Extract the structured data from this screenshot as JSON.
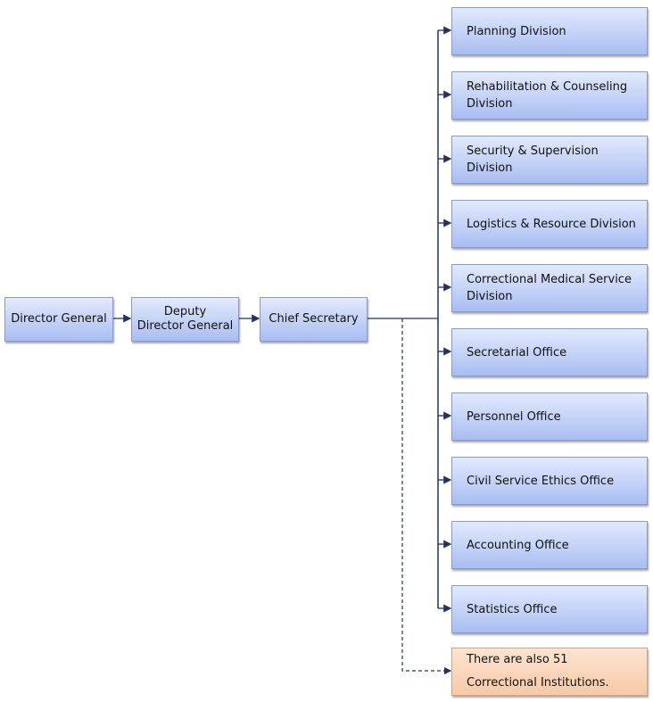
{
  "chain": [
    {
      "label": "Director General"
    },
    {
      "label": "Deputy\nDirector General",
      "line1": "Deputy",
      "line2": "Director General"
    },
    {
      "label": "Chief Secretary"
    }
  ],
  "units": [
    {
      "line1": "Planning Division",
      "line2": ""
    },
    {
      "line1": "Rehabilitation & Counseling",
      "line2": "Division"
    },
    {
      "line1": "Security & Supervision",
      "line2": "Division"
    },
    {
      "line1": "Logistics & Resource Division",
      "line2": ""
    },
    {
      "line1": "Correctional Medical Service",
      "line2": "Division"
    },
    {
      "line1": "Secretarial Office",
      "line2": ""
    },
    {
      "line1": "Personnel Office",
      "line2": ""
    },
    {
      "line1": "Civil Service Ethics Office",
      "line2": ""
    },
    {
      "line1": "Accounting Office",
      "line2": ""
    },
    {
      "line1": "Statistics Office",
      "line2": ""
    }
  ],
  "note": {
    "line1": "There are also 51",
    "line2": "Correctional Institutions."
  },
  "colors": {
    "connector": "#1f3366",
    "box_fill": "#b7c8f5",
    "note_fill": "#fad5b9"
  }
}
